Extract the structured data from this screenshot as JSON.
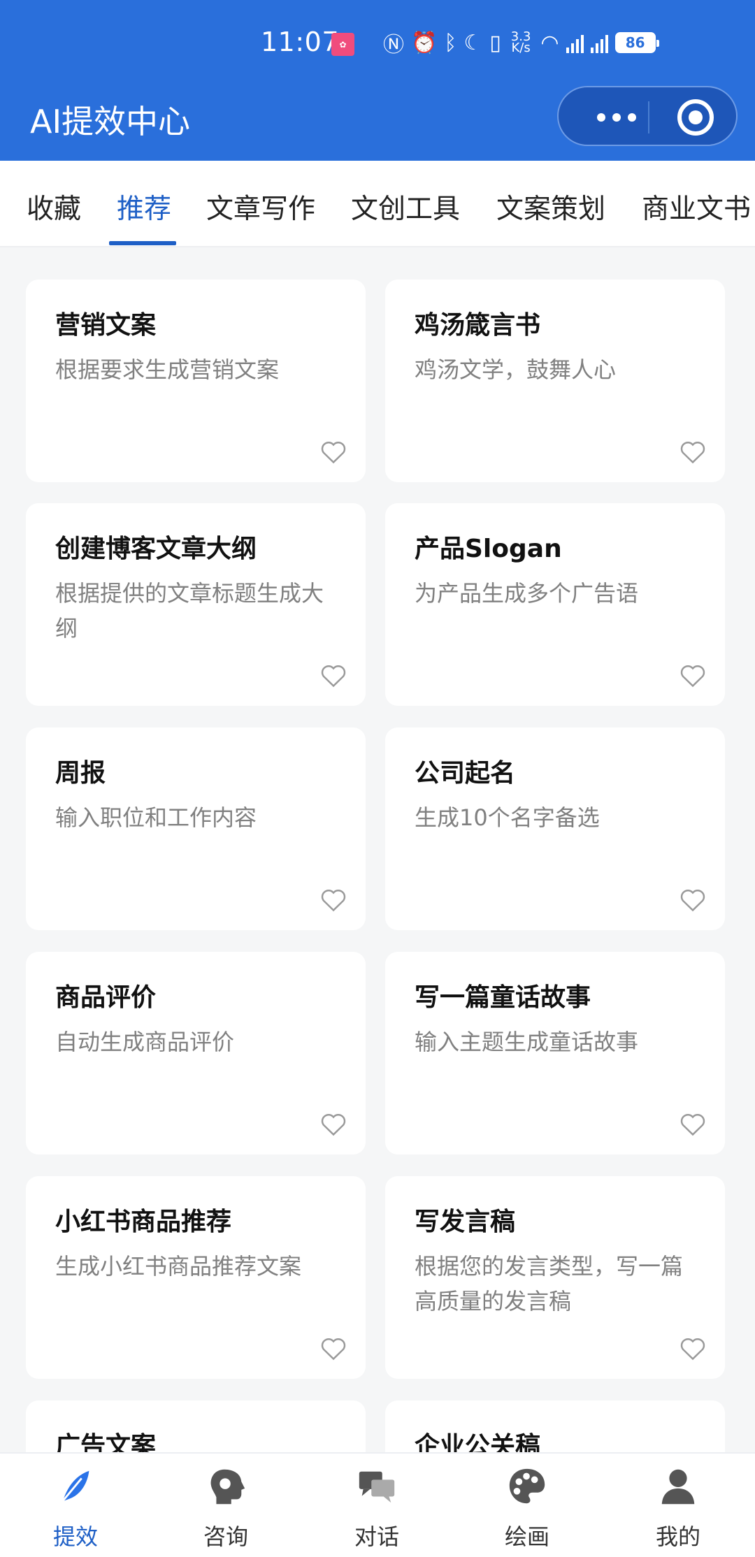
{
  "status_bar": {
    "time": "11:07",
    "net_speed_top": "3.3",
    "net_speed_bottom": "K/s",
    "battery": "86"
  },
  "header": {
    "title": "AI提效中心"
  },
  "tabs": [
    {
      "label": "收藏"
    },
    {
      "label": "推荐",
      "active": true
    },
    {
      "label": "文章写作"
    },
    {
      "label": "文创工具"
    },
    {
      "label": "文案策划"
    },
    {
      "label": "商业文书"
    }
  ],
  "cards": [
    {
      "name": "营销文案",
      "desc": "根据要求生成营销文案"
    },
    {
      "name": "鸡汤箴言书",
      "desc": "鸡汤文学，鼓舞人心"
    },
    {
      "name": "创建博客文章大纲",
      "desc": "根据提供的文章标题生成大纲"
    },
    {
      "name": "产品Slogan",
      "desc": "为产品生成多个广告语"
    },
    {
      "name": "周报",
      "desc": "输入职位和工作内容"
    },
    {
      "name": "公司起名",
      "desc": "生成10个名字备选"
    },
    {
      "name": "商品评价",
      "desc": "自动生成商品评价"
    },
    {
      "name": "写一篇童话故事",
      "desc": "输入主题生成童话故事"
    },
    {
      "name": "小红书商品推荐",
      "desc": "生成小红书商品推荐文案"
    },
    {
      "name": "写发言稿",
      "desc": "根据您的发言类型，写一篇高质量的发言稿"
    },
    {
      "name": "广告文案",
      "desc": ""
    },
    {
      "name": "企业公关稿",
      "desc": ""
    }
  ],
  "bottom_nav": [
    {
      "label": "提效",
      "icon": "feather-icon",
      "active": true
    },
    {
      "label": "咨询",
      "icon": "head-icon"
    },
    {
      "label": "对话",
      "icon": "chat-icon"
    },
    {
      "label": "绘画",
      "icon": "palette-icon"
    },
    {
      "label": "我的",
      "icon": "user-icon"
    }
  ],
  "colors": {
    "primary": "#2a6fdb",
    "active": "#1e5fc6",
    "background": "#f5f6f7"
  }
}
